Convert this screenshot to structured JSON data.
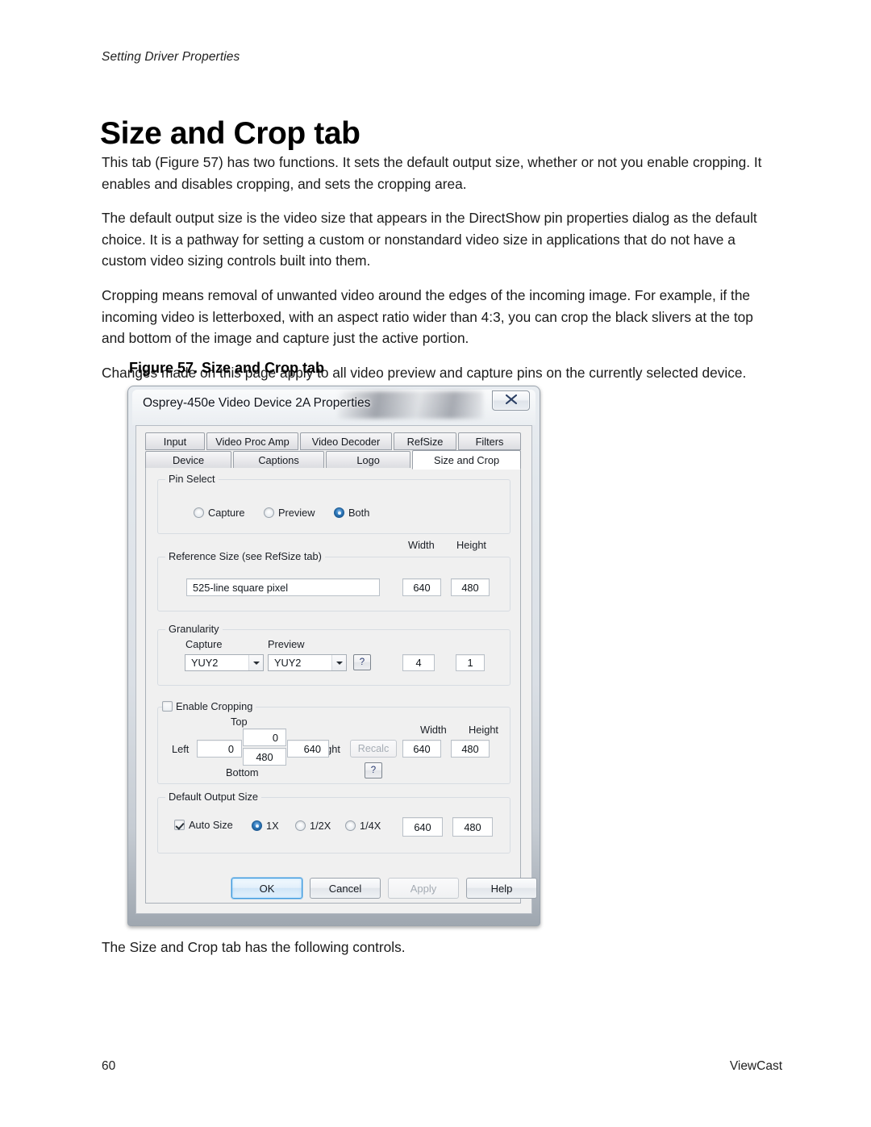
{
  "page": {
    "running_head": "Setting Driver Properties",
    "title": "Size and Crop tab",
    "paragraphs": [
      "This tab (Figure 57) has two functions. It sets the default output size, whether or not you enable cropping. It enables and disables cropping, and sets the cropping area.",
      "The default output size is the video size that appears in the DirectShow pin properties dialog as the default choice. It is a pathway for setting a custom or nonstandard video size in applications that do not have a custom video sizing controls built into them.",
      "Cropping means removal of unwanted video around the edges of the incoming image. For example, if the incoming video is letterboxed, with an aspect ratio wider than 4:3, you can crop the black slivers at the top and bottom of the image and capture just the active portion.",
      "Changes made on this page apply to all video preview and capture pins on the currently selected device."
    ],
    "figure_caption": "Figure 57. Size and Crop tab",
    "tail_text": "The Size and Crop tab has the following controls.",
    "footer_page": "60",
    "footer_brand": "ViewCast"
  },
  "dialog": {
    "title": "Osprey-450e Video Device 2A Properties",
    "close_label": "Close",
    "tabs_row1": [
      {
        "label": "Input",
        "selected": false
      },
      {
        "label": "Video Proc Amp",
        "selected": false
      },
      {
        "label": "Video Decoder",
        "selected": false
      },
      {
        "label": "RefSize",
        "selected": false
      },
      {
        "label": "Filters",
        "selected": false
      }
    ],
    "tabs_row2": [
      {
        "label": "Device",
        "selected": false
      },
      {
        "label": "Captions",
        "selected": false
      },
      {
        "label": "Logo",
        "selected": false
      },
      {
        "label": "Size and Crop",
        "selected": true
      }
    ],
    "pin_select": {
      "title": "Pin Select",
      "options": [
        {
          "label": "Capture",
          "selected": false
        },
        {
          "label": "Preview",
          "selected": false
        },
        {
          "label": "Both",
          "selected": true
        }
      ]
    },
    "reference_size": {
      "title": "Reference Size  (see RefSize tab)",
      "width_label": "Width",
      "height_label": "Height",
      "value": "525-line square pixel",
      "width": "640",
      "height": "480"
    },
    "granularity": {
      "title": "Granularity",
      "capture_label": "Capture",
      "preview_label": "Preview",
      "capture_value": "YUY2",
      "preview_value": "YUY2",
      "help_label": "?",
      "gran_width": "4",
      "gran_height": "1"
    },
    "cropping": {
      "title": "Enable Cropping",
      "enabled": false,
      "top_label": "Top",
      "bottom_label": "Bottom",
      "left_label": "Left",
      "right_label": "Right",
      "width_label": "Width",
      "height_label": "Height",
      "top": "0",
      "bottom": "480",
      "left": "0",
      "right": "640",
      "recalc_label": "Recalc",
      "help_label": "?",
      "width": "640",
      "height": "480"
    },
    "default_output_size": {
      "title": "Default Output Size",
      "auto_size_label": "Auto Size",
      "auto_size_checked": true,
      "scale_options": [
        {
          "label": "1X",
          "selected": true
        },
        {
          "label": "1/2X",
          "selected": false
        },
        {
          "label": "1/4X",
          "selected": false
        }
      ],
      "width": "640",
      "height": "480"
    },
    "buttons": [
      {
        "label": "OK",
        "state": "default"
      },
      {
        "label": "Cancel",
        "state": "normal"
      },
      {
        "label": "Apply",
        "state": "disabled"
      },
      {
        "label": "Help",
        "state": "normal"
      }
    ]
  }
}
